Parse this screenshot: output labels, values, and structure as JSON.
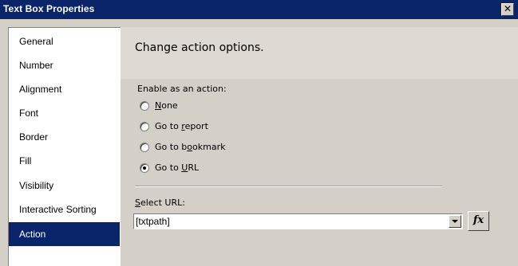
{
  "window": {
    "title": "Text Box Properties",
    "close_glyph": "✕"
  },
  "sidebar": {
    "items": [
      {
        "label": "General"
      },
      {
        "label": "Number"
      },
      {
        "label": "Alignment"
      },
      {
        "label": "Font"
      },
      {
        "label": "Border"
      },
      {
        "label": "Fill"
      },
      {
        "label": "Visibility"
      },
      {
        "label": "Interactive Sorting"
      },
      {
        "label": "Action"
      }
    ],
    "selected": "Action"
  },
  "panel": {
    "title": "Change action options.",
    "enable_label": "Enable as an action:",
    "options": [
      {
        "pre": "",
        "accel": "N",
        "post": "one",
        "checked": false
      },
      {
        "pre": "Go to ",
        "accel": "r",
        "post": "eport",
        "checked": false
      },
      {
        "pre": "Go to b",
        "accel": "o",
        "post": "okmark",
        "checked": false
      },
      {
        "pre": "Go to ",
        "accel": "U",
        "post": "RL",
        "checked": true
      }
    ],
    "url_label_accel": "S",
    "url_label_rest": "elect URL:",
    "url_value": "[txtpath]",
    "fx_label": "fx"
  },
  "colors": {
    "titlebar": "#0a246a",
    "selection": "#0a246a",
    "dialog_bg": "#d4d0c8"
  }
}
